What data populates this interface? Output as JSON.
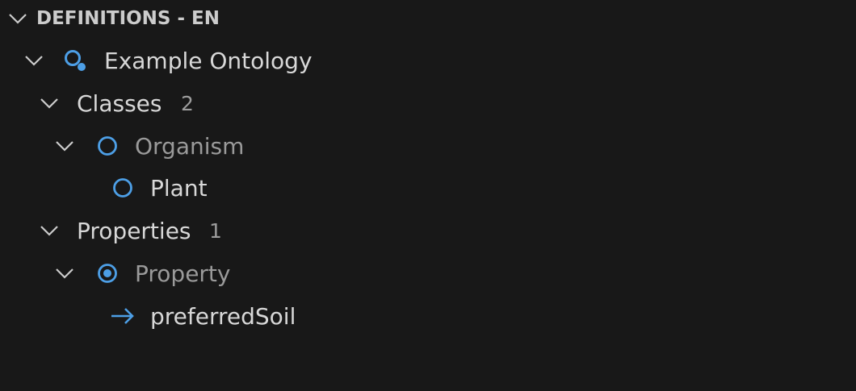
{
  "section": {
    "title": "DEFINITIONS - EN"
  },
  "tree": {
    "ontology": {
      "label": "Example Ontology",
      "icon": "ontology-search-icon"
    },
    "classes": {
      "label": "Classes",
      "count": "2",
      "items": [
        {
          "label": "Organism",
          "icon": "circle-outline-icon",
          "expanded": true
        },
        {
          "label": "Plant",
          "icon": "circle-outline-icon"
        }
      ]
    },
    "properties": {
      "label": "Properties",
      "count": "1",
      "items": [
        {
          "label": "Property",
          "icon": "radio-dot-icon",
          "expanded": true
        },
        {
          "label": "preferredSoil",
          "icon": "arrow-right-icon"
        }
      ]
    }
  },
  "colors": {
    "background": "#181818",
    "icon_blue": "#4d9fe6",
    "text": "#d8d8d8",
    "text_dim": "#9a9a9a",
    "header": "#cccccc"
  }
}
